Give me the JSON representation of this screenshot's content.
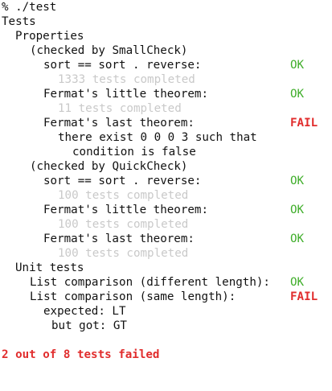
{
  "terminal": {
    "command": "% ./test",
    "root_group": "Tests",
    "properties": {
      "title": "Properties",
      "smallcheck": {
        "title": "(checked by SmallCheck)",
        "tests": [
          {
            "name": "sort == sort . reverse:",
            "status": "OK",
            "detail": "1333 tests completed"
          },
          {
            "name": "Fermat's little theorem:",
            "status": "OK",
            "detail": "11 tests completed"
          },
          {
            "name": "Fermat's last theorem:",
            "status": "FAIL",
            "message_lines": [
              "there exist 0 0 0 3 such that",
              "condition is false"
            ]
          }
        ]
      },
      "quickcheck": {
        "title": "(checked by QuickCheck)",
        "tests": [
          {
            "name": "sort == sort . reverse:",
            "status": "OK",
            "detail": "100 tests completed"
          },
          {
            "name": "Fermat's little theorem:",
            "status": "OK",
            "detail": "100 tests completed"
          },
          {
            "name": "Fermat's last theorem:",
            "status": "OK",
            "detail": "100 tests completed"
          }
        ]
      }
    },
    "unit_tests": {
      "title": "Unit tests",
      "tests": [
        {
          "name": "List comparison (different length):",
          "status": "OK"
        },
        {
          "name": "List comparison (same length):",
          "status": "FAIL",
          "expected": "expected: LT",
          "got": "but got: GT"
        }
      ]
    },
    "summary": "2 out of 8 tests failed"
  },
  "colors": {
    "ok": "#3fae2a",
    "fail": "#e12d2d",
    "faint": "#c9c9c9",
    "text": "#111111"
  }
}
